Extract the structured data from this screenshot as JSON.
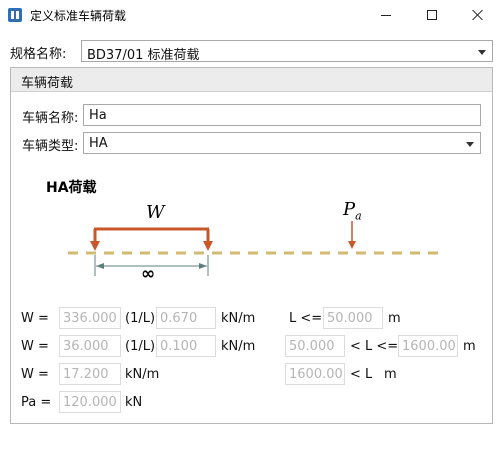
{
  "window": {
    "title": "定义标准车辆荷载"
  },
  "spec": {
    "label": "规格名称:",
    "value": "BD37/01 标准荷载"
  },
  "group": {
    "title": "车辆荷载",
    "vehicle_name_label": "车辆名称:",
    "vehicle_name_value": "Ha",
    "vehicle_type_label": "车辆类型:",
    "vehicle_type_value": "HA"
  },
  "diagram": {
    "title": "HA荷载",
    "w_symbol": "W",
    "pa_symbol": "P",
    "pa_sub": "a",
    "span_symbol": "∞"
  },
  "params": {
    "row1": {
      "label": "W =",
      "w_value": "336.000",
      "div": "(1/L)",
      "exp_value": "0.670",
      "unit": "kN/m",
      "cond_label": "L <=",
      "l_max": "50.000",
      "l_unit": "m"
    },
    "row2": {
      "label": "W =",
      "w_value": "36.000",
      "div": "(1/L)",
      "exp_value": "0.100",
      "unit": "kN/m",
      "l_min": "50.000",
      "cond_label": "< L <=",
      "l_max": "1600.00",
      "l_unit": "m"
    },
    "row3": {
      "label": "W =",
      "w_value": "17.200",
      "unit": "kN/m",
      "l_min": "1600.00",
      "cond_label": "< L",
      "l_unit": "m"
    },
    "row4": {
      "label": "Pa =",
      "pa_value": "120.000",
      "unit": "kN"
    }
  },
  "colors": {
    "load_arrow": "#c8572a",
    "baseline": "#d2ba73",
    "dimension": "#5f7f7f"
  }
}
